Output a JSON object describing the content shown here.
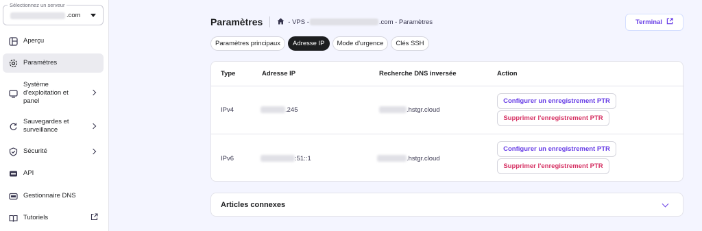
{
  "sidebar": {
    "server_select": {
      "legend": "Sélectionnez un serveur",
      "value_suffix": ".com"
    },
    "items": [
      {
        "label": "Aperçu",
        "icon": "layout-icon"
      },
      {
        "label": "Paramètres",
        "icon": "gear-icon",
        "active": true
      },
      {
        "label": "Système d'exploitation et panel",
        "icon": "monitor-icon"
      },
      {
        "label": "Sauvegardes et surveillance",
        "icon": "refresh-icon"
      },
      {
        "label": "Sécurité",
        "icon": "shield-icon"
      },
      {
        "label": "API",
        "icon": "api-icon"
      },
      {
        "label": "Gestionnaire DNS",
        "icon": "dns-icon"
      },
      {
        "label": "Tutoriels",
        "icon": "book-icon"
      }
    ]
  },
  "header": {
    "title": "Paramètres",
    "breadcrumb": {
      "part1": "- VPS -",
      "part2": ".com - Paramètres"
    },
    "terminal_label": "Terminal"
  },
  "tabs": [
    {
      "label": "Paramètres principaux"
    },
    {
      "label": "Adresse IP",
      "active": true
    },
    {
      "label": "Mode d'urgence"
    },
    {
      "label": "Clés SSH"
    }
  ],
  "table": {
    "columns": [
      "Type",
      "Adresse IP",
      "Recherche DNS inversée",
      "Action"
    ],
    "rows": [
      {
        "type": "IPv4",
        "ip_suffix": ".245",
        "dns_suffix": ".hstgr.cloud",
        "configure_label": "Configurer un enregistrement PTR",
        "delete_label": "Supprimer l'enregistrement PTR"
      },
      {
        "type": "IPv6",
        "ip_suffix": ":51::1",
        "dns_suffix": ".hstgr.cloud",
        "configure_label": "Configurer un enregistrement PTR",
        "delete_label": "Supprimer l'enregistrement PTR"
      }
    ]
  },
  "articles": {
    "title": "Articles connexes"
  },
  "colors": {
    "accent": "#673de6",
    "danger": "#d63163",
    "background": "#f4f5ff"
  }
}
